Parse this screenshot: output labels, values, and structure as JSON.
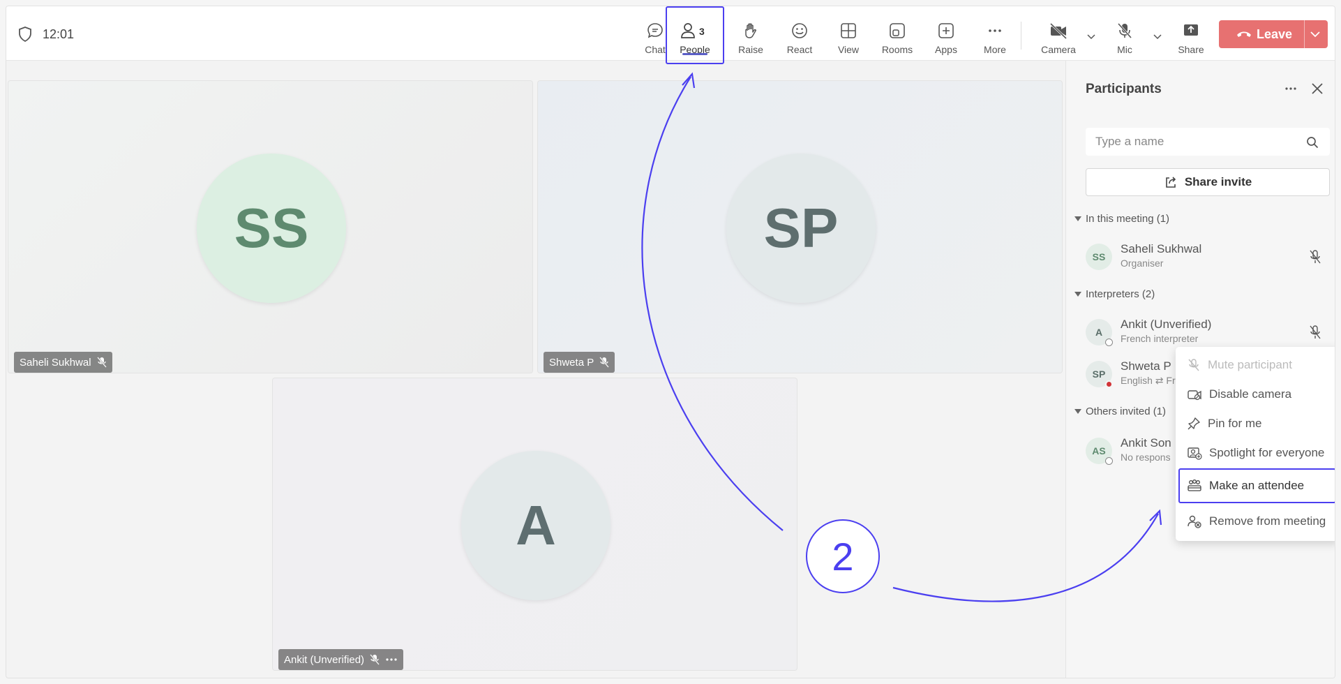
{
  "topbar": {
    "time": "12:01",
    "tools": [
      {
        "id": "chat",
        "label": "Chat",
        "icon": "chat-icon"
      },
      {
        "id": "people",
        "label": "People",
        "icon": "people-icon",
        "count": "3"
      },
      {
        "id": "raise",
        "label": "Raise",
        "icon": "hand-icon"
      },
      {
        "id": "react",
        "label": "React",
        "icon": "smiley-icon"
      },
      {
        "id": "view",
        "label": "View",
        "icon": "grid-icon"
      },
      {
        "id": "rooms",
        "label": "Rooms",
        "icon": "rooms-icon"
      },
      {
        "id": "apps",
        "label": "Apps",
        "icon": "plus-square-icon"
      },
      {
        "id": "more",
        "label": "More",
        "icon": "ellipsis-icon"
      },
      {
        "id": "camera",
        "label": "Camera",
        "icon": "camera-off-icon"
      },
      {
        "id": "mic",
        "label": "Mic",
        "icon": "mic-off-icon"
      },
      {
        "id": "share",
        "label": "Share",
        "icon": "share-tray-icon"
      }
    ],
    "leave_label": "Leave"
  },
  "tiles": [
    {
      "initials": "SS",
      "name": "Saheli Sukhwal"
    },
    {
      "initials": "SP",
      "name": "Shweta P"
    },
    {
      "initials": "A",
      "name": "Ankit (Unverified)"
    }
  ],
  "panel": {
    "title": "Participants",
    "search_placeholder": "Type a name",
    "share_invite": "Share invite",
    "sections": {
      "in_meeting": "In this meeting (1)",
      "interpreters": "Interpreters (2)",
      "others": "Others invited (1)"
    },
    "people": [
      {
        "initials": "SS",
        "name": "Saheli Sukhwal",
        "role": "Organiser"
      },
      {
        "initials": "A",
        "name": "Ankit (Unverified)",
        "role": "French interpreter"
      },
      {
        "initials": "SP",
        "name": "Shweta P",
        "role": "English ⇄ Fr"
      },
      {
        "initials": "AS",
        "name": "Ankit Son",
        "role": "No respons"
      }
    ]
  },
  "menu": {
    "items": [
      {
        "label": "Mute participant",
        "icon": "mic-off-icon",
        "state": "disabled"
      },
      {
        "label": "Disable camera",
        "icon": "camera-off-icon"
      },
      {
        "label": "Pin for me",
        "icon": "pin-icon"
      },
      {
        "label": "Spotlight for everyone",
        "icon": "spotlight-icon"
      },
      {
        "label": "Make an attendee",
        "icon": "attendee-icon",
        "state": "highlighted"
      },
      {
        "label": "Remove from meeting",
        "icon": "remove-person-icon"
      }
    ]
  },
  "annotation": {
    "step": "2",
    "color": "#4b3ff0"
  },
  "colors": {
    "leave": "#e77171",
    "accent": "#5b5fc7",
    "ss_avatar": "#dcefe2",
    "ss_text": "#5e8a6f",
    "sp_text": "#5e6e6e",
    "a_text": "#5e6e70"
  }
}
